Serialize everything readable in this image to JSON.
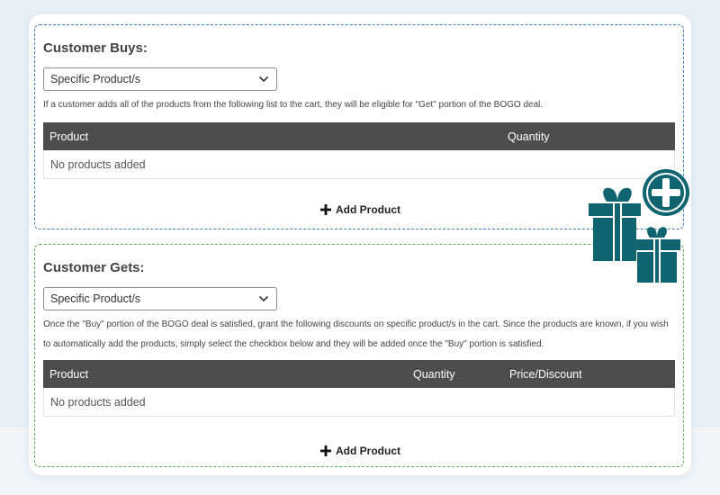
{
  "buys": {
    "title": "Customer Buys:",
    "select_value": "Specific Product/s",
    "description": "If a customer adds all of the products from the following list to the cart, they will be eligible for \"Get\" portion of the BOGO deal.",
    "columns": [
      "Product",
      "Quantity"
    ],
    "empty_text": "No products added",
    "add_label": "Add Product"
  },
  "gets": {
    "title": "Customer Gets:",
    "select_value": "Specific Product/s",
    "description": "Once the \"Buy\" portion of the BOGO deal is satisfied, grant the following discounts on specific product/s in the cart. Since the products are known, if you wish to automatically add the products, simply select the checkbox below and they will be added once the \"Buy\" portion is satisfied.",
    "columns": [
      "Product",
      "Quantity",
      "Price/Discount"
    ],
    "empty_text": "No products added",
    "add_label": "Add Product"
  },
  "colors": {
    "buys_border": "#3d7fbd",
    "gets_border": "#5fb25b",
    "table_header": "#4d4d4d",
    "gift_teal": "#0f6470"
  },
  "icons": {
    "gift_art": "gift-boxes-with-plus-icon",
    "select_chevron": "chevron-down-icon",
    "add": "plus-icon"
  }
}
